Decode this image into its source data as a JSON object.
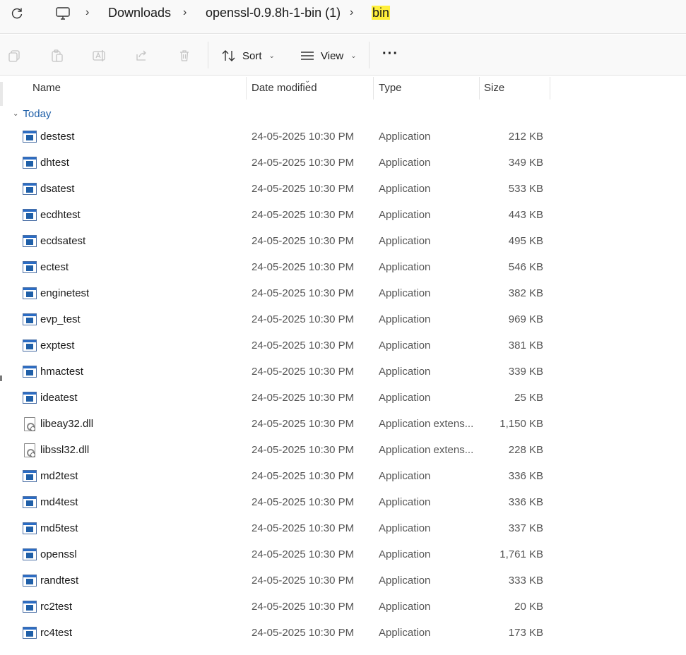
{
  "address": {
    "crumbs": [
      "Downloads",
      "openssl-0.9.8h-1-bin (1)",
      "bin"
    ],
    "pc_icon": "monitor-icon",
    "refresh_icon": "refresh-icon"
  },
  "toolbar": {
    "sort_label": "Sort",
    "view_label": "View",
    "more_label": "···"
  },
  "columns": {
    "name": "Name",
    "date": "Date modified",
    "type": "Type",
    "size": "Size"
  },
  "group": {
    "label": "Today"
  },
  "files": [
    {
      "name": "destest",
      "date": "24-05-2025 10:30 PM",
      "type": "Application",
      "size": "212 KB",
      "icon": "exe"
    },
    {
      "name": "dhtest",
      "date": "24-05-2025 10:30 PM",
      "type": "Application",
      "size": "349 KB",
      "icon": "exe"
    },
    {
      "name": "dsatest",
      "date": "24-05-2025 10:30 PM",
      "type": "Application",
      "size": "533 KB",
      "icon": "exe"
    },
    {
      "name": "ecdhtest",
      "date": "24-05-2025 10:30 PM",
      "type": "Application",
      "size": "443 KB",
      "icon": "exe"
    },
    {
      "name": "ecdsatest",
      "date": "24-05-2025 10:30 PM",
      "type": "Application",
      "size": "495 KB",
      "icon": "exe"
    },
    {
      "name": "ectest",
      "date": "24-05-2025 10:30 PM",
      "type": "Application",
      "size": "546 KB",
      "icon": "exe"
    },
    {
      "name": "enginetest",
      "date": "24-05-2025 10:30 PM",
      "type": "Application",
      "size": "382 KB",
      "icon": "exe"
    },
    {
      "name": "evp_test",
      "date": "24-05-2025 10:30 PM",
      "type": "Application",
      "size": "969 KB",
      "icon": "exe"
    },
    {
      "name": "exptest",
      "date": "24-05-2025 10:30 PM",
      "type": "Application",
      "size": "381 KB",
      "icon": "exe"
    },
    {
      "name": "hmactest",
      "date": "24-05-2025 10:30 PM",
      "type": "Application",
      "size": "339 KB",
      "icon": "exe"
    },
    {
      "name": "ideatest",
      "date": "24-05-2025 10:30 PM",
      "type": "Application",
      "size": "25 KB",
      "icon": "exe"
    },
    {
      "name": "libeay32.dll",
      "date": "24-05-2025 10:30 PM",
      "type": "Application extens...",
      "size": "1,150 KB",
      "icon": "dll"
    },
    {
      "name": "libssl32.dll",
      "date": "24-05-2025 10:30 PM",
      "type": "Application extens...",
      "size": "228 KB",
      "icon": "dll"
    },
    {
      "name": "md2test",
      "date": "24-05-2025 10:30 PM",
      "type": "Application",
      "size": "336 KB",
      "icon": "exe"
    },
    {
      "name": "md4test",
      "date": "24-05-2025 10:30 PM",
      "type": "Application",
      "size": "336 KB",
      "icon": "exe"
    },
    {
      "name": "md5test",
      "date": "24-05-2025 10:30 PM",
      "type": "Application",
      "size": "337 KB",
      "icon": "exe"
    },
    {
      "name": "openssl",
      "date": "24-05-2025 10:30 PM",
      "type": "Application",
      "size": "1,761 KB",
      "icon": "exe"
    },
    {
      "name": "randtest",
      "date": "24-05-2025 10:30 PM",
      "type": "Application",
      "size": "333 KB",
      "icon": "exe"
    },
    {
      "name": "rc2test",
      "date": "24-05-2025 10:30 PM",
      "type": "Application",
      "size": "20 KB",
      "icon": "exe"
    },
    {
      "name": "rc4test",
      "date": "24-05-2025 10:30 PM",
      "type": "Application",
      "size": "173 KB",
      "icon": "exe"
    }
  ],
  "colors": {
    "highlight": "#ffef3a",
    "group_text": "#1f5fa8",
    "exe_blue": "#2b6cc4"
  }
}
